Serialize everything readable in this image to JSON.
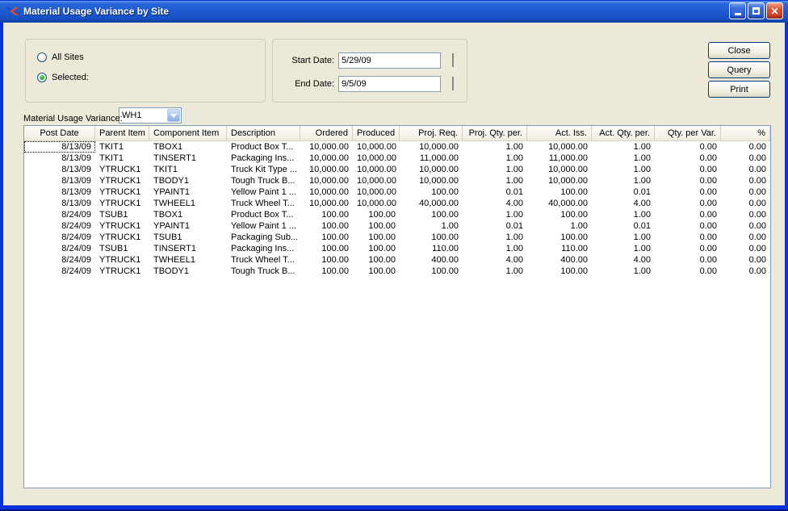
{
  "window": {
    "title": "Material Usage Variance by Site"
  },
  "filters": {
    "all_sites_label": "All Sites",
    "selected_label": "Selected:",
    "site_value": "WH1",
    "start_date_label": "Start Date:",
    "start_date_value": "5/29/09",
    "end_date_label": "End Date:",
    "end_date_value": "9/5/09"
  },
  "actions": {
    "close_label": "Close",
    "query_label": "Query",
    "print_label": "Print"
  },
  "colors": {
    "window_background": "#ECE9D8",
    "frame_blue": "#0831D9",
    "titlebar_blue": "#1D5AD0",
    "close_button_red": "#E0532F",
    "textbox_border": "#7F9DB9",
    "radio_selected_green": "#21A121"
  },
  "table": {
    "caption": "Material Usage Variance:",
    "columns": [
      {
        "label": "Post Date",
        "width": 88,
        "header_align": "center",
        "align": "right"
      },
      {
        "label": "Parent Item",
        "width": 67,
        "header_align": "left",
        "align": "left"
      },
      {
        "label": "Component Item",
        "width": 96,
        "header_align": "left",
        "align": "left"
      },
      {
        "label": "Description",
        "width": 91,
        "header_align": "left",
        "align": "left"
      },
      {
        "label": "Ordered",
        "width": 65,
        "header_align": "right",
        "align": "right"
      },
      {
        "label": "Produced",
        "width": 58,
        "header_align": "right",
        "align": "right"
      },
      {
        "label": "Proj. Req.",
        "width": 78,
        "header_align": "right",
        "align": "right"
      },
      {
        "label": "Proj. Qty. per.",
        "width": 80,
        "header_align": "right",
        "align": "right"
      },
      {
        "label": "Act. Iss.",
        "width": 80,
        "header_align": "right",
        "align": "right"
      },
      {
        "label": "Act. Qty. per.",
        "width": 78,
        "header_align": "right",
        "align": "right"
      },
      {
        "label": "Qty. per Var.",
        "width": 82,
        "header_align": "right",
        "align": "right"
      },
      {
        "label": "%",
        "width": 61,
        "header_align": "right",
        "align": "right"
      }
    ],
    "rows": [
      [
        "8/13/09",
        "TKIT1",
        "TBOX1",
        "Product Box T...",
        "10,000.00",
        "10,000.00",
        "10,000.00",
        "1.00",
        "10,000.00",
        "1.00",
        "0.00",
        "0.00"
      ],
      [
        "8/13/09",
        "TKIT1",
        "TINSERT1",
        "Packaging Ins...",
        "10,000.00",
        "10,000.00",
        "11,000.00",
        "1.00",
        "11,000.00",
        "1.00",
        "0.00",
        "0.00"
      ],
      [
        "8/13/09",
        "YTRUCK1",
        "TKIT1",
        "Truck Kit Type ...",
        "10,000.00",
        "10,000.00",
        "10,000.00",
        "1.00",
        "10,000.00",
        "1.00",
        "0.00",
        "0.00"
      ],
      [
        "8/13/09",
        "YTRUCK1",
        "TBODY1",
        "Tough Truck B...",
        "10,000.00",
        "10,000.00",
        "10,000.00",
        "1.00",
        "10,000.00",
        "1.00",
        "0.00",
        "0.00"
      ],
      [
        "8/13/09",
        "YTRUCK1",
        "YPAINT1",
        "Yellow Paint 1 ...",
        "10,000.00",
        "10,000.00",
        "100.00",
        "0.01",
        "100.00",
        "0.01",
        "0.00",
        "0.00"
      ],
      [
        "8/13/09",
        "YTRUCK1",
        "TWHEEL1",
        "Truck Wheel T...",
        "10,000.00",
        "10,000.00",
        "40,000.00",
        "4.00",
        "40,000.00",
        "4.00",
        "0.00",
        "0.00"
      ],
      [
        "8/24/09",
        "TSUB1",
        "TBOX1",
        "Product Box T...",
        "100.00",
        "100.00",
        "100.00",
        "1.00",
        "100.00",
        "1.00",
        "0.00",
        "0.00"
      ],
      [
        "8/24/09",
        "YTRUCK1",
        "YPAINT1",
        "Yellow Paint 1 ...",
        "100.00",
        "100.00",
        "1.00",
        "0.01",
        "1.00",
        "0.01",
        "0.00",
        "0.00"
      ],
      [
        "8/24/09",
        "YTRUCK1",
        "TSUB1",
        "Packaging Sub...",
        "100.00",
        "100.00",
        "100.00",
        "1.00",
        "100.00",
        "1.00",
        "0.00",
        "0.00"
      ],
      [
        "8/24/09",
        "TSUB1",
        "TINSERT1",
        "Packaging Ins...",
        "100.00",
        "100.00",
        "110.00",
        "1.00",
        "110.00",
        "1.00",
        "0.00",
        "0.00"
      ],
      [
        "8/24/09",
        "YTRUCK1",
        "TWHEEL1",
        "Truck Wheel T...",
        "100.00",
        "100.00",
        "400.00",
        "4.00",
        "400.00",
        "4.00",
        "0.00",
        "0.00"
      ],
      [
        "8/24/09",
        "YTRUCK1",
        "TBODY1",
        "Tough Truck B...",
        "100.00",
        "100.00",
        "100.00",
        "1.00",
        "100.00",
        "1.00",
        "0.00",
        "0.00"
      ]
    ],
    "focused_cell": {
      "row": 0,
      "col": 0
    }
  }
}
